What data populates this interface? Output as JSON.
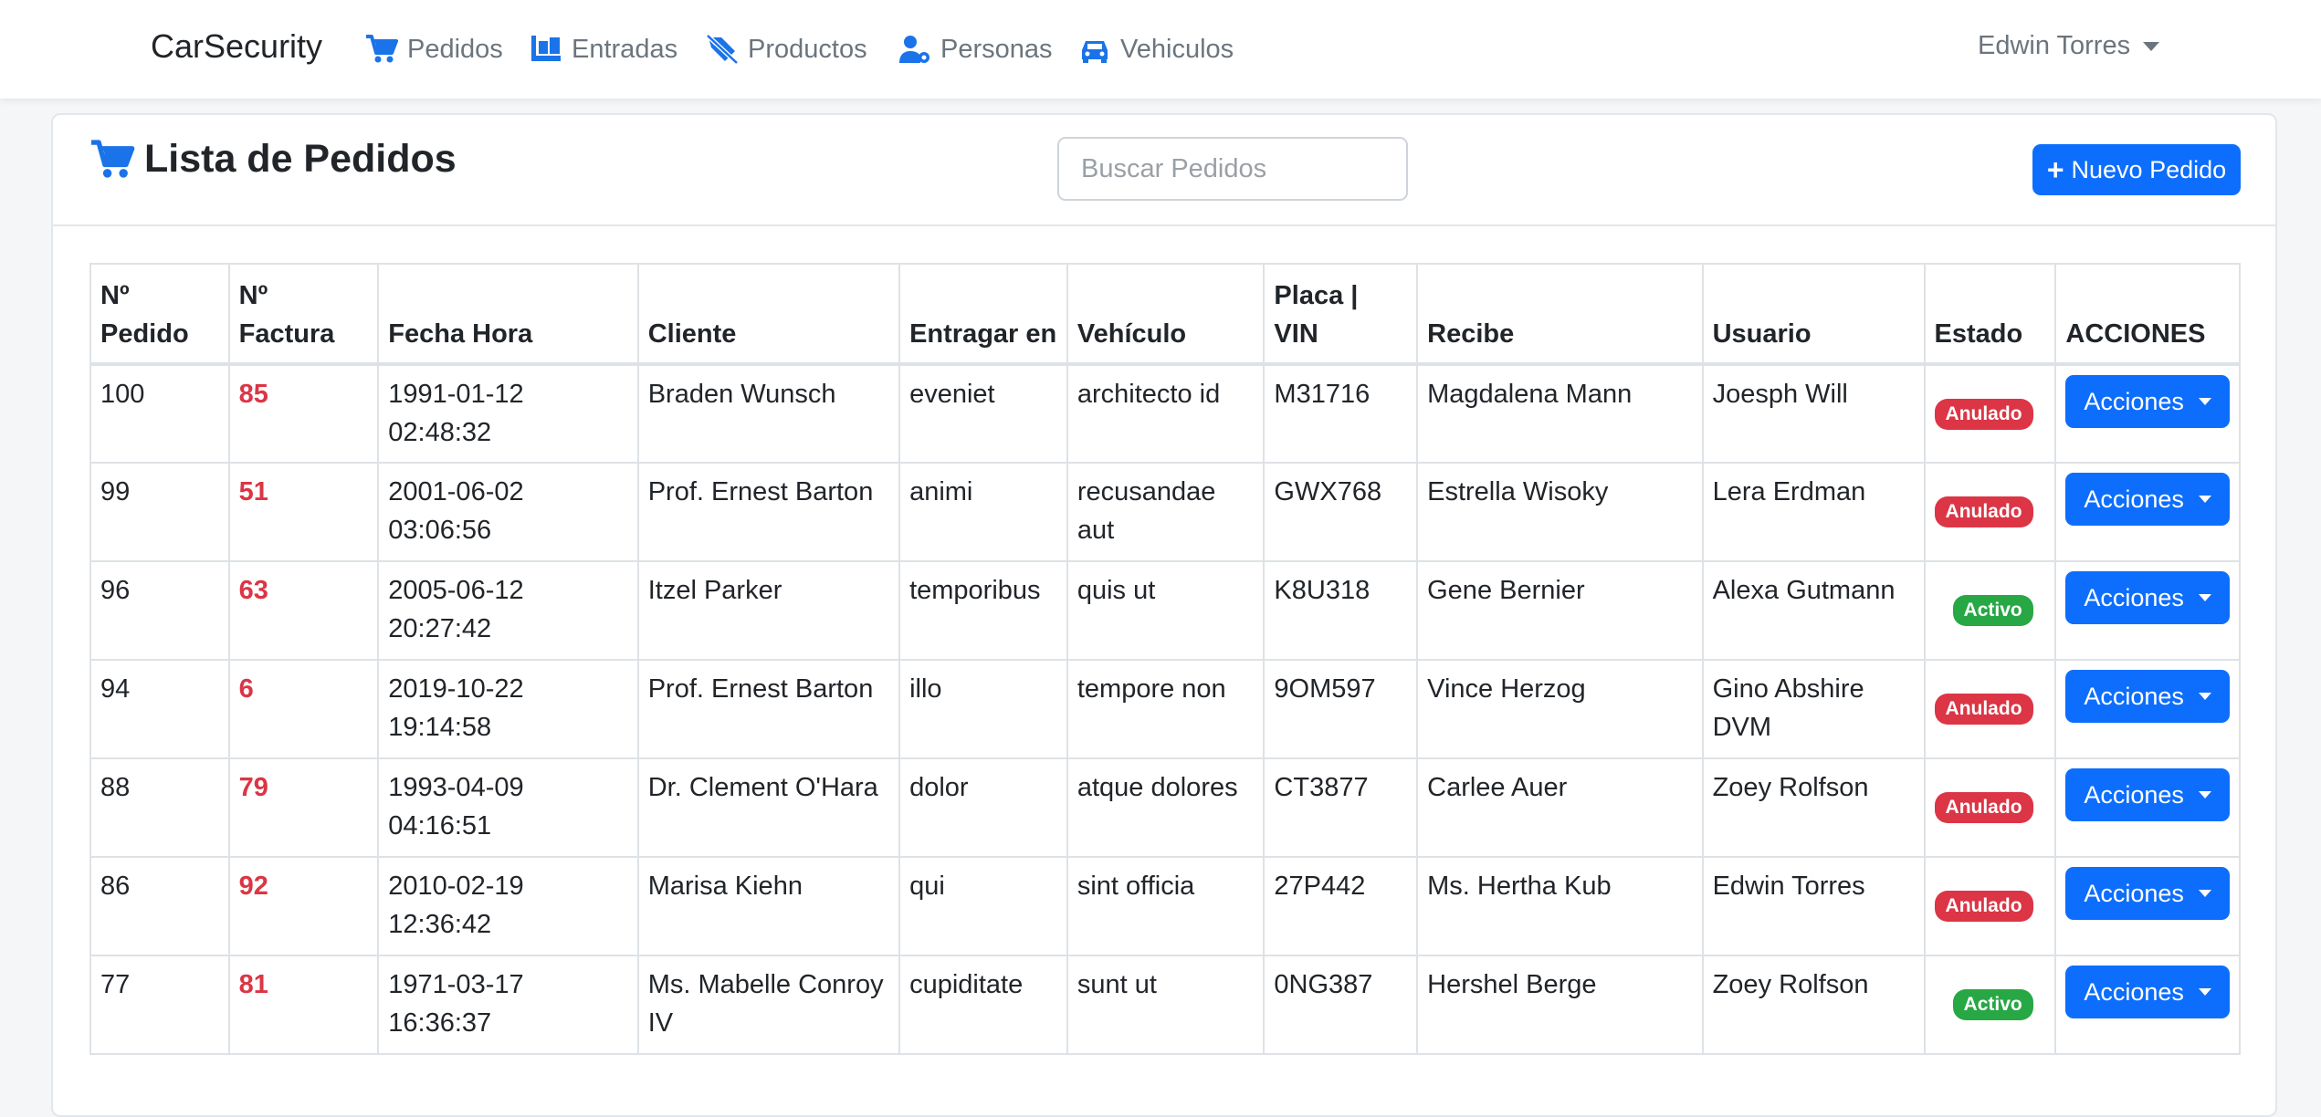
{
  "brand": "CarSecurity",
  "nav": {
    "pedidos": "Pedidos",
    "entradas": "Entradas",
    "productos": "Productos",
    "personas": "Personas",
    "vehiculos": "Vehiculos"
  },
  "user": {
    "name": "Edwin Torres"
  },
  "card": {
    "title": "Lista de Pedidos",
    "search_placeholder": "Buscar Pedidos",
    "new_button": "Nuevo Pedido"
  },
  "colors": {
    "primary": "#0d6efd",
    "danger": "#dc3545",
    "success": "#28a745"
  },
  "table": {
    "headers": [
      "Nº Pedido",
      "Nº Factura",
      "Fecha Hora",
      "Cliente",
      "Entragar en",
      "Vehículo",
      "Placa | VIN",
      "Recibe",
      "Usuario",
      "Estado",
      "ACCIONES"
    ],
    "rows": [
      {
        "pedido": "100",
        "factura": "85",
        "fecha": "1991-01-12",
        "hora": "02:48:32",
        "cliente": "Braden Wunsch",
        "entregar": "eveniet",
        "vehiculo": "architecto id",
        "placa": "M31716",
        "recibe": "Magdalena Mann",
        "usuario": "Joesph Will",
        "estado": "Anulado",
        "accion": "Acciones"
      },
      {
        "pedido": "99",
        "factura": "51",
        "fecha": "2001-06-02",
        "hora": "03:06:56",
        "cliente": "Prof. Ernest Barton",
        "entregar": "animi",
        "vehiculo": "recusandae aut",
        "placa": "GWX768",
        "recibe": "Estrella Wisoky",
        "usuario": "Lera Erdman",
        "estado": "Anulado",
        "accion": "Acciones"
      },
      {
        "pedido": "96",
        "factura": "63",
        "fecha": "2005-06-12",
        "hora": "20:27:42",
        "cliente": "Itzel Parker",
        "entregar": "temporibus",
        "vehiculo": "quis ut",
        "placa": "K8U318",
        "recibe": "Gene Bernier",
        "usuario": "Alexa Gutmann",
        "estado": "Activo",
        "accion": "Acciones"
      },
      {
        "pedido": "94",
        "factura": "6",
        "fecha": "2019-10-22",
        "hora": "19:14:58",
        "cliente": "Prof. Ernest Barton",
        "entregar": "illo",
        "vehiculo": "tempore non",
        "placa": "9OM597",
        "recibe": "Vince Herzog",
        "usuario": "Gino Abshire DVM",
        "estado": "Anulado",
        "accion": "Acciones"
      },
      {
        "pedido": "88",
        "factura": "79",
        "fecha": "1993-04-09",
        "hora": "04:16:51",
        "cliente": "Dr. Clement O'Hara",
        "entregar": "dolor",
        "vehiculo": "atque dolores",
        "placa": "CT3877",
        "recibe": "Carlee Auer",
        "usuario": "Zoey Rolfson",
        "estado": "Anulado",
        "accion": "Acciones"
      },
      {
        "pedido": "86",
        "factura": "92",
        "fecha": "2010-02-19",
        "hora": "12:36:42",
        "cliente": "Marisa Kiehn",
        "entregar": "qui",
        "vehiculo": "sint officia",
        "placa": "27P442",
        "recibe": "Ms. Hertha Kub",
        "usuario": "Edwin Torres",
        "estado": "Anulado",
        "accion": "Acciones"
      },
      {
        "pedido": "77",
        "factura": "81",
        "fecha": "1971-03-17",
        "hora": "16:36:37",
        "cliente": "Ms. Mabelle Conroy IV",
        "entregar": "cupiditate",
        "vehiculo": "sunt ut",
        "placa": "0NG387",
        "recibe": "Hershel Berge",
        "usuario": "Zoey Rolfson",
        "estado": "Activo",
        "accion": "Acciones"
      }
    ]
  }
}
